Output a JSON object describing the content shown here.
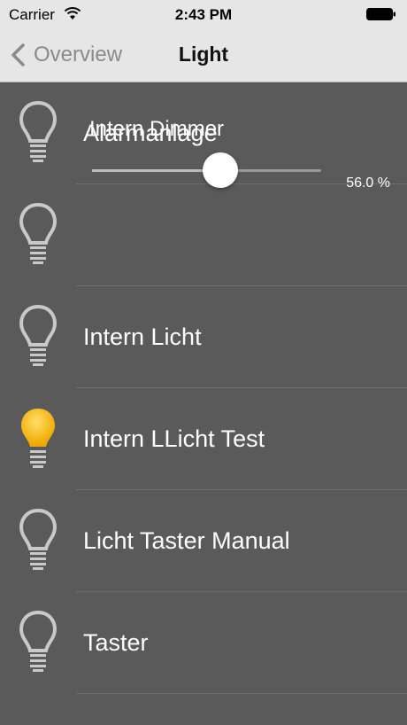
{
  "status_bar": {
    "carrier": "Carrier",
    "time": "2:43 PM",
    "icons": [
      "wifi-icon",
      "battery-icon"
    ]
  },
  "nav": {
    "back_label": "Overview",
    "back_icon": "chevron-left-icon",
    "title": "Light"
  },
  "items": [
    {
      "label": "Alarmanlage",
      "icon": "lightbulb-icon",
      "state": "off"
    },
    {
      "label": "Intern Dimmer",
      "icon": "lightbulb-icon",
      "state": "off",
      "slider_value": 0.56,
      "value_text": "56.0 %"
    },
    {
      "label": "Intern Licht",
      "icon": "lightbulb-icon",
      "state": "off"
    },
    {
      "label": "Intern LLicht Test",
      "icon": "lightbulb-icon",
      "state": "on"
    },
    {
      "label": "Licht Taster Manual",
      "icon": "lightbulb-icon",
      "state": "off"
    },
    {
      "label": "Taster",
      "icon": "lightbulb-icon",
      "state": "off"
    }
  ],
  "colors": {
    "bulb_off": "#c9c9c9",
    "bulb_on": "#f5c518",
    "background": "#5a5a5a",
    "bar": "#e6e6e6"
  }
}
